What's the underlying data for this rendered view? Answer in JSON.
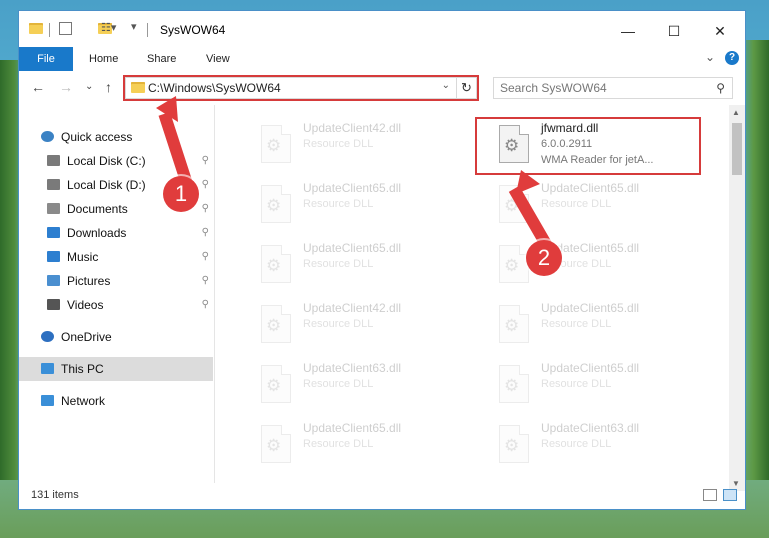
{
  "window": {
    "title": "SysWOW64",
    "controls": {
      "minimize": "—",
      "maximize": "☐",
      "close": "✕"
    }
  },
  "ribbon": {
    "tabs": [
      "File",
      "Home",
      "Share",
      "View"
    ],
    "expand_glyph": "⌄",
    "help_glyph": "?"
  },
  "address": {
    "path": "C:\\Windows\\SysWOW64",
    "dropdown_glyph": "⌄",
    "refresh_glyph": "↻",
    "back_glyph": "←",
    "forward_glyph": "→",
    "recent_glyph": "⌄",
    "up_glyph": "↑"
  },
  "search": {
    "placeholder": "Search SysWOW64",
    "icon": "search-icon"
  },
  "nav": {
    "pin_glyph": "📌",
    "items": [
      {
        "label": "Quick access",
        "icon": "star-icon",
        "pinned": false
      },
      {
        "label": "Local Disk (C:)",
        "icon": "drive-icon",
        "pinned": true
      },
      {
        "label": "Local Disk (D:)",
        "icon": "drive-icon",
        "pinned": true
      },
      {
        "label": "Documents",
        "icon": "documents-icon",
        "pinned": true
      },
      {
        "label": "Downloads",
        "icon": "downloads-icon",
        "pinned": true
      },
      {
        "label": "Music",
        "icon": "music-icon",
        "pinned": true
      },
      {
        "label": "Pictures",
        "icon": "pictures-icon",
        "pinned": true
      },
      {
        "label": "Videos",
        "icon": "videos-icon",
        "pinned": true
      },
      {
        "label": "OneDrive",
        "icon": "cloud-icon",
        "pinned": false
      },
      {
        "label": "This PC",
        "icon": "computer-icon",
        "pinned": false,
        "selected": true
      },
      {
        "label": "Network",
        "icon": "network-icon",
        "pinned": false
      }
    ]
  },
  "files": {
    "highlighted": {
      "name": "jfwmard.dll",
      "version": "6.0.0.2911",
      "description": "WMA Reader for jetA..."
    },
    "items": [
      {
        "name": "UpdateClient42.dll",
        "type": "Resource DLL"
      },
      {
        "name": "UpdateClient65.dll",
        "type": "Resource DLL"
      },
      {
        "name": "UpdateClient65.dll",
        "type": "Resource DLL"
      },
      {
        "name": "UpdateClient42.dll",
        "type": "Resource DLL"
      },
      {
        "name": "UpdateClient63.dll",
        "type": "Resource DLL"
      },
      {
        "name": "UpdateClient65.dll",
        "type": "Resource DLL"
      },
      {
        "name": "UpdateClient65.dll",
        "type": "Resource DLL"
      },
      {
        "name": "UpdateClient65.dll",
        "type": "Resource DLL"
      },
      {
        "name": "UpdateClient65.dll",
        "type": "Resource DLL"
      },
      {
        "name": "UpdateClient65.dll",
        "type": "Resource DLL"
      },
      {
        "name": "UpdateClient63.dll",
        "type": "Resource DLL"
      },
      {
        "name": "UpdateClient5.dll",
        "type": "Resource DLL"
      }
    ]
  },
  "status": {
    "item_count": "131 items"
  },
  "annotations": {
    "step1": "1",
    "step2": "2",
    "highlight_color": "#d63b3b"
  }
}
